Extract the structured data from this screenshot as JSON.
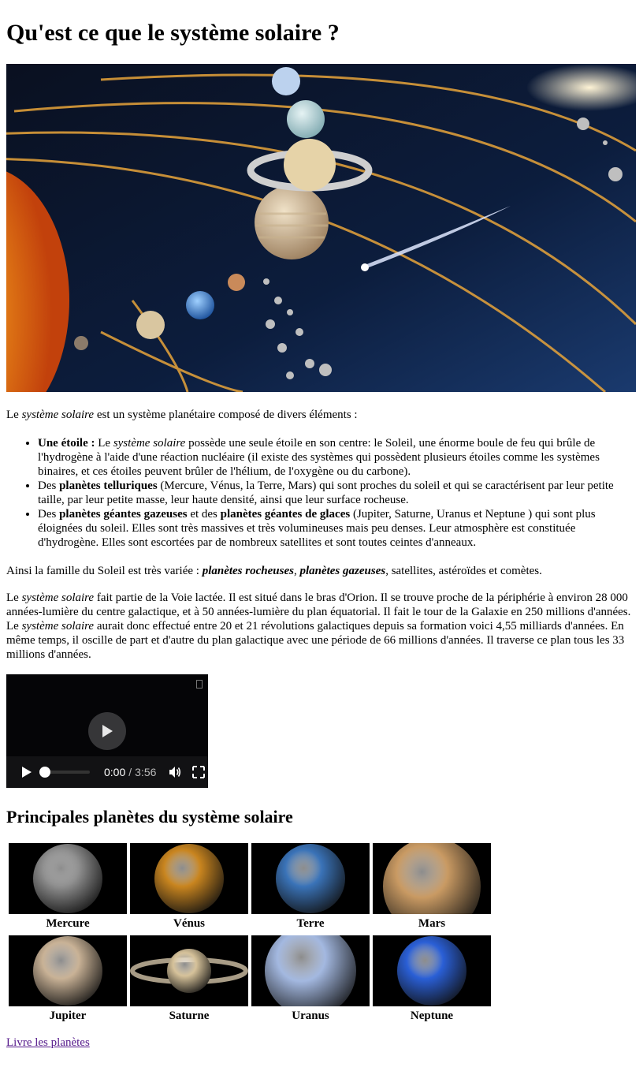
{
  "page": {
    "title": "Qu'est ce que le système solaire ?"
  },
  "hero_image": {
    "icon": "solar-system-illustration"
  },
  "intro": {
    "pre": "Le ",
    "em": "système solaire",
    "post": " est un système planétaire composé de divers éléments :"
  },
  "list": {
    "item1": {
      "strong": "Une étoile :",
      "t1": " Le ",
      "em": "système solaire",
      "t2": " possède une seule étoile en son centre: le Soleil, une énorme boule de feu qui brûle de l'hydrogène à l'aide d'une réaction nucléaire (il existe des systèmes qui possèdent plusieurs étoiles comme les systèmes binaires, et ces étoiles peuvent brûler de l'hélium, de l'oxygène ou du carbone)."
    },
    "item2": {
      "t1": "Des ",
      "strong": "planètes telluriques",
      "t2": " (Mercure, Vénus, la Terre, Mars) qui sont proches du soleil et qui se caractérisent par leur petite taille, par leur petite masse, leur haute densité, ainsi que leur surface rocheuse."
    },
    "item3": {
      "t1": "Des ",
      "strong1": "planètes géantes gazeuses",
      "t2": " et des ",
      "strong2": "planètes géantes de glaces",
      "t3": " (Jupiter, Saturne, Uranus et Neptune ) qui sont plus éloignées du soleil. Elles sont très massives et très volumineuses mais peu denses. Leur atmosphère est constituée d'hydrogène. Elles sont escortées par de nombreux satellites et sont toutes ceintes d'anneaux."
    }
  },
  "famille": {
    "t1": "Ainsi la famille du Soleil est très variée : ",
    "s1": "planètes rocheuses",
    "t2": ", ",
    "s2": "planètes gazeuses",
    "t3": ", satellites, astéroïdes et comètes."
  },
  "voie": {
    "t1": "Le ",
    "em1": "système solaire",
    "t2": " fait partie de la Voie lactée. Il est situé dans le bras d'Orion. Il se trouve proche de la périphérie à environ 28 000 années-lumière du centre galactique, et à 50 années-lumière du plan équatorial. Il fait le tour de la Galaxie en 250 millions d'années. Le ",
    "em2": "système solaire",
    "t3": " aurait donc effectué entre 20 et 21 révolutions galactiques depuis sa formation voici 4,55 milliards d'années. En même temps, il oscille de part et d'autre du plan galactique avec une période de 66 millions d'années. Il traverse ce plan tous les 33 millions d'années."
  },
  "video": {
    "current_time": "0:00",
    "separator": "/",
    "duration": "3:56",
    "progress": 0
  },
  "planets_section": {
    "title": "Principales planètes du système solaire",
    "items": [
      {
        "name": "Mercure",
        "color": "#8f8f8f"
      },
      {
        "name": "Vénus",
        "color": "#c9851f"
      },
      {
        "name": "Terre",
        "color": "#3a73b8"
      },
      {
        "name": "Mars",
        "color": "#c99a63"
      },
      {
        "name": "Jupiter",
        "color": "#c9b296"
      },
      {
        "name": "Saturne",
        "color": "#d6c29a"
      },
      {
        "name": "Uranus",
        "color": "#a3b8e0"
      },
      {
        "name": "Neptune",
        "color": "#2a5fd6"
      }
    ]
  },
  "footer_link": {
    "label": "Livre les planètes"
  }
}
